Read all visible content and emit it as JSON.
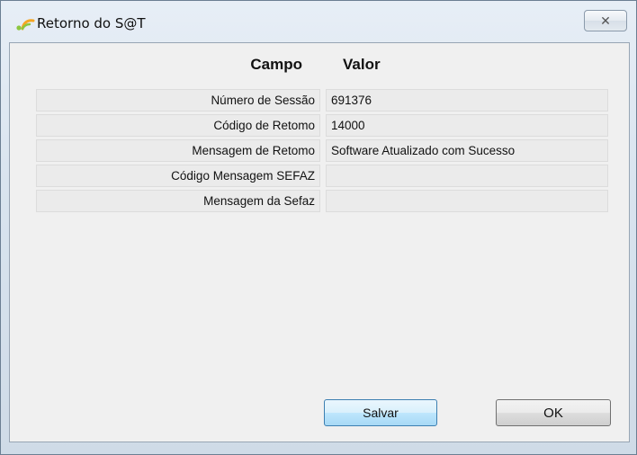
{
  "window": {
    "title": "Retorno do S@T",
    "close_icon": "close-icon",
    "app_icon": "sat-logo-icon"
  },
  "table": {
    "headers": {
      "campo": "Campo",
      "valor": "Valor"
    },
    "rows": [
      {
        "campo": "Número de Sessão",
        "valor": "691376"
      },
      {
        "campo": "Código de Retomo",
        "valor": "14000"
      },
      {
        "campo": "Mensagem de Retomo",
        "valor": "Software Atualizado com Sucesso"
      },
      {
        "campo": "Código Mensagem SEFAZ",
        "valor": ""
      },
      {
        "campo": "Mensagem da Sefaz",
        "valor": ""
      }
    ]
  },
  "buttons": {
    "save_label": "Salvar",
    "ok_label": "OK"
  }
}
